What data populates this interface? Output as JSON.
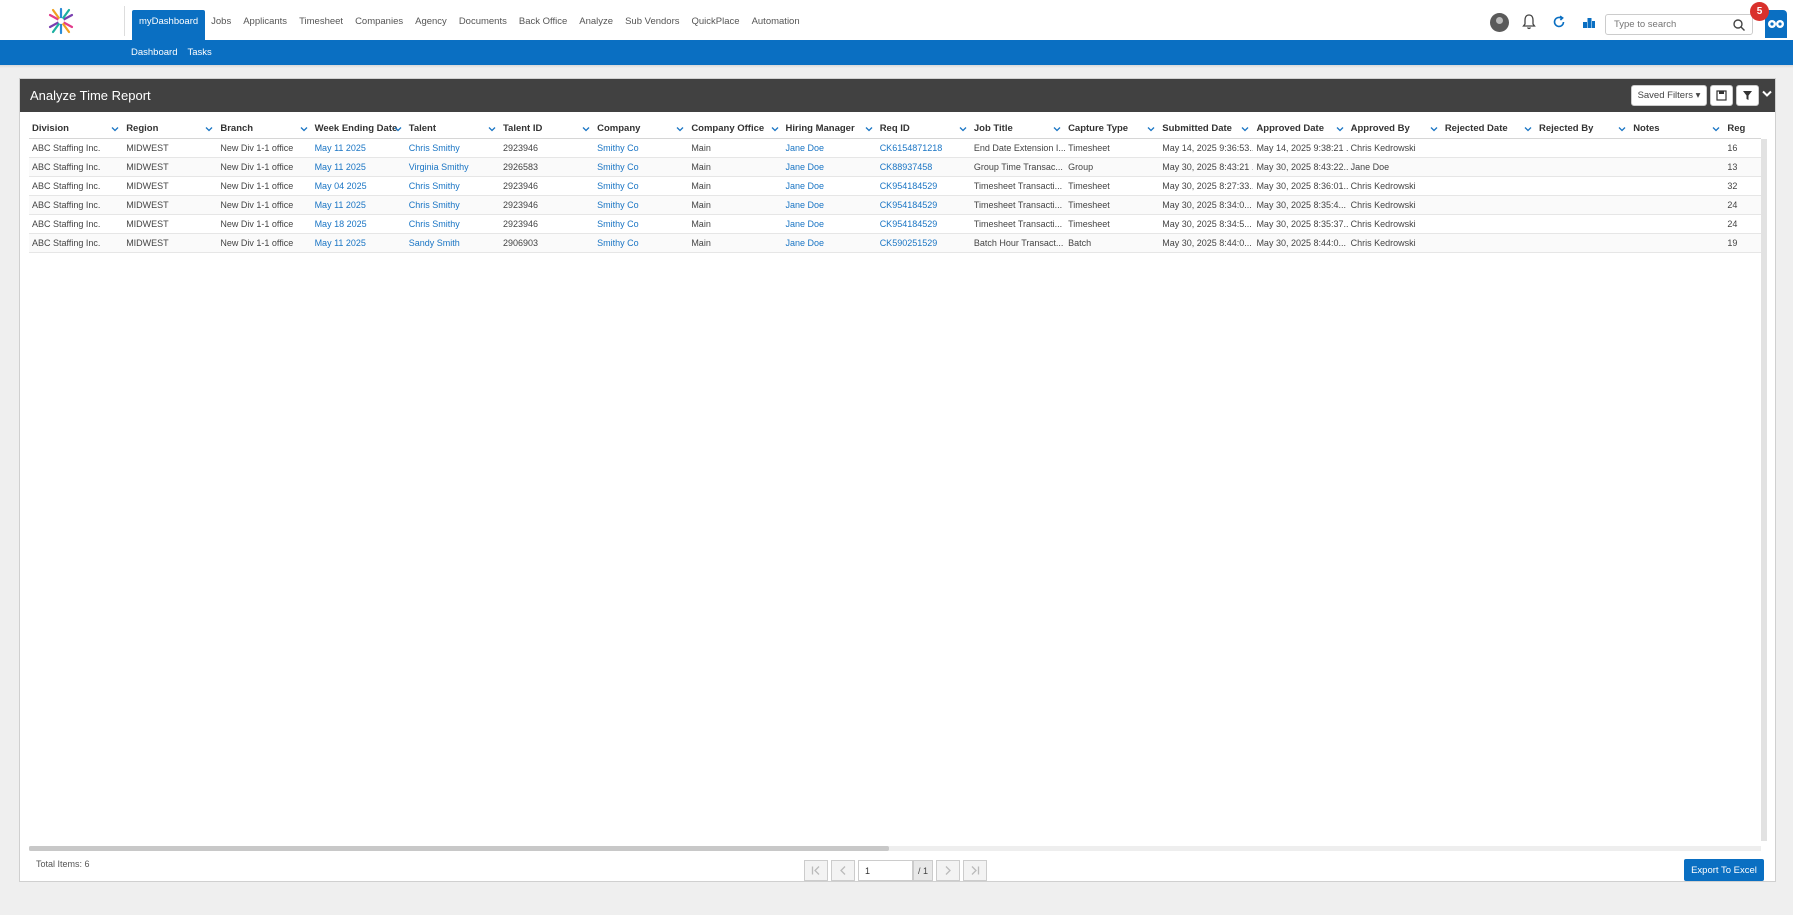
{
  "nav": {
    "items": [
      "myDashboard",
      "Jobs",
      "Applicants",
      "Timesheet",
      "Companies",
      "Agency",
      "Documents",
      "Back Office",
      "Analyze",
      "Sub Vendors",
      "QuickPlace",
      "Automation"
    ],
    "active": "myDashboard"
  },
  "subnav": {
    "items": [
      "Dashboard",
      "Tasks"
    ]
  },
  "search": {
    "placeholder": "Type to search"
  },
  "notifications": {
    "count": "5"
  },
  "panel": {
    "title": "Analyze Time Report",
    "saved_filters_label": "Saved Filters"
  },
  "grid": {
    "columns": [
      "Division",
      "Region",
      "Branch",
      "Week Ending Date",
      "Talent",
      "Talent ID",
      "Company",
      "Company Office",
      "Hiring Manager",
      "Req ID",
      "Job Title",
      "Capture Type",
      "Submitted Date",
      "Approved Date",
      "Approved By",
      "Rejected Date",
      "Rejected By",
      "Notes",
      "Reg"
    ],
    "rows": [
      [
        "ABC Staffing Inc.",
        "MIDWEST",
        "New Div 1-1 office",
        "May 11 2025",
        "Chris Smithy",
        "2923946",
        "Smithy Co",
        "Main",
        "Jane Doe",
        "CK6154871218",
        "End Date Extension I...",
        "Timesheet",
        "May 14, 2025 9:36:53...",
        "May 14, 2025 9:38:21 ...",
        "Chris Kedrowski",
        "",
        "",
        "",
        "16"
      ],
      [
        "ABC Staffing Inc.",
        "MIDWEST",
        "New Div 1-1 office",
        "May 11 2025",
        "Virginia Smithy",
        "2926583",
        "Smithy Co",
        "Main",
        "Jane Doe",
        "CK88937458",
        "Group Time Transac...",
        "Group",
        "May 30, 2025 8:43:21 ...",
        "May 30, 2025 8:43:22...",
        "Jane Doe",
        "",
        "",
        "",
        "13"
      ],
      [
        "ABC Staffing Inc.",
        "MIDWEST",
        "New Div 1-1 office",
        "May 04 2025",
        "Chris Smithy",
        "2923946",
        "Smithy Co",
        "Main",
        "Jane Doe",
        "CK954184529",
        "Timesheet Transacti...",
        "Timesheet",
        "May 30, 2025 8:27:33...",
        "May 30, 2025 8:36:01...",
        "Chris Kedrowski",
        "",
        "",
        "",
        "32"
      ],
      [
        "ABC Staffing Inc.",
        "MIDWEST",
        "New Div 1-1 office",
        "May 11 2025",
        "Chris Smithy",
        "2923946",
        "Smithy Co",
        "Main",
        "Jane Doe",
        "CK954184529",
        "Timesheet Transacti...",
        "Timesheet",
        "May 30, 2025 8:34:0...",
        "May 30, 2025 8:35:4...",
        "Chris Kedrowski",
        "",
        "",
        "",
        "24"
      ],
      [
        "ABC Staffing Inc.",
        "MIDWEST",
        "New Div 1-1 office",
        "May 18 2025",
        "Chris Smithy",
        "2923946",
        "Smithy Co",
        "Main",
        "Jane Doe",
        "CK954184529",
        "Timesheet Transacti...",
        "Timesheet",
        "May 30, 2025 8:34:5...",
        "May 30, 2025 8:35:37...",
        "Chris Kedrowski",
        "",
        "",
        "",
        "24"
      ],
      [
        "ABC Staffing Inc.",
        "MIDWEST",
        "New Div 1-1 office",
        "May 11 2025",
        "Sandy Smith",
        "2906903",
        "Smithy Co",
        "Main",
        "Jane Doe",
        "CK590251529",
        "Batch Hour Transact...",
        "Batch",
        "May 30, 2025 8:44:0...",
        "May 30, 2025 8:44:0...",
        "Chris Kedrowski",
        "",
        "",
        "",
        "19"
      ]
    ],
    "link_columns": [
      3,
      4,
      6,
      8,
      9
    ]
  },
  "footer": {
    "total_items": "Total Items: 6",
    "page_value": "1",
    "page_total": "/ 1",
    "export_label": "Export To Excel"
  },
  "colors": {
    "brand": "#0a6fc2",
    "header_bar": "#414141",
    "link": "#1a75c4",
    "badge": "#d9302b"
  },
  "icons": [
    "user-avatar-icon",
    "bell-icon",
    "refresh-icon",
    "org-chart-icon",
    "search-icon",
    "owl-assistant-icon",
    "save-icon",
    "filter-icon",
    "chevron-down-icon",
    "first-page-icon",
    "prev-page-icon",
    "next-page-icon",
    "last-page-icon"
  ]
}
